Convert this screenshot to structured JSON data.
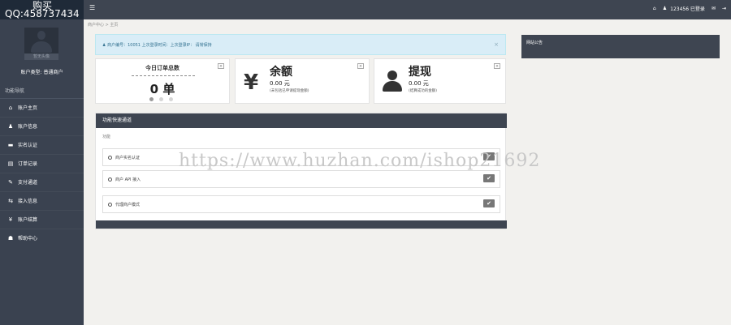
{
  "brand": {
    "line1": "购买",
    "line2": "QQ:458737434"
  },
  "sidebar": {
    "avatar_caption": "暂无头像",
    "user_type_label": "账户类型:",
    "user_type_value": "普通商户",
    "nav_header": "功能导航",
    "items": [
      {
        "label": "账户主页",
        "icon": "home-icon",
        "glyph": "⌂"
      },
      {
        "label": "账户信息",
        "icon": "user-icon",
        "glyph": "♟"
      },
      {
        "label": "实名认证",
        "icon": "id-card-icon",
        "glyph": "▬"
      },
      {
        "label": "订单记录",
        "icon": "list-icon",
        "glyph": "▤"
      },
      {
        "label": "支付通道",
        "icon": "wrench-icon",
        "glyph": "✎"
      },
      {
        "label": "接入信息",
        "icon": "exchange-icon",
        "glyph": "⇆"
      },
      {
        "label": "账户结算",
        "icon": "yen-icon",
        "glyph": "¥"
      },
      {
        "label": "帮助中心",
        "icon": "group-icon",
        "glyph": "☗"
      }
    ]
  },
  "topbar": {
    "menu_icon": "bars-icon",
    "home_icon": "home-icon",
    "user_text": "123456 已登录",
    "chat_icon": "comment-icon",
    "logout_icon": "sign-out-icon"
  },
  "breadcrumb": {
    "home": "商户中心",
    "sep": ">",
    "current": "主页"
  },
  "alert": {
    "text": "商户编号：10051 上次登录时间：上次登录IP：  请常保持",
    "close": "×"
  },
  "cards": {
    "orders": {
      "title": "今日订单总数",
      "count": "0 单"
    },
    "balance": {
      "title": "余额",
      "value": "0.00 元",
      "note": "(未包括已申请提现金额)",
      "icon": "yen-icon",
      "glyph": "¥"
    },
    "withdraw": {
      "title": "提现",
      "value": "0.00 元",
      "note": "(结算成功的金额)",
      "icon": "user-icon"
    },
    "close": "×"
  },
  "quick": {
    "header": "功能快速通道",
    "sub": "功能",
    "rows": [
      {
        "label": "商户实名认证"
      },
      {
        "label": "商户 API 接入"
      },
      {
        "label": "代理商户模式"
      }
    ],
    "check": "✔"
  },
  "notice": {
    "title": "网站公告"
  },
  "watermark": "https://www.huzhan.com/ishop21692"
}
